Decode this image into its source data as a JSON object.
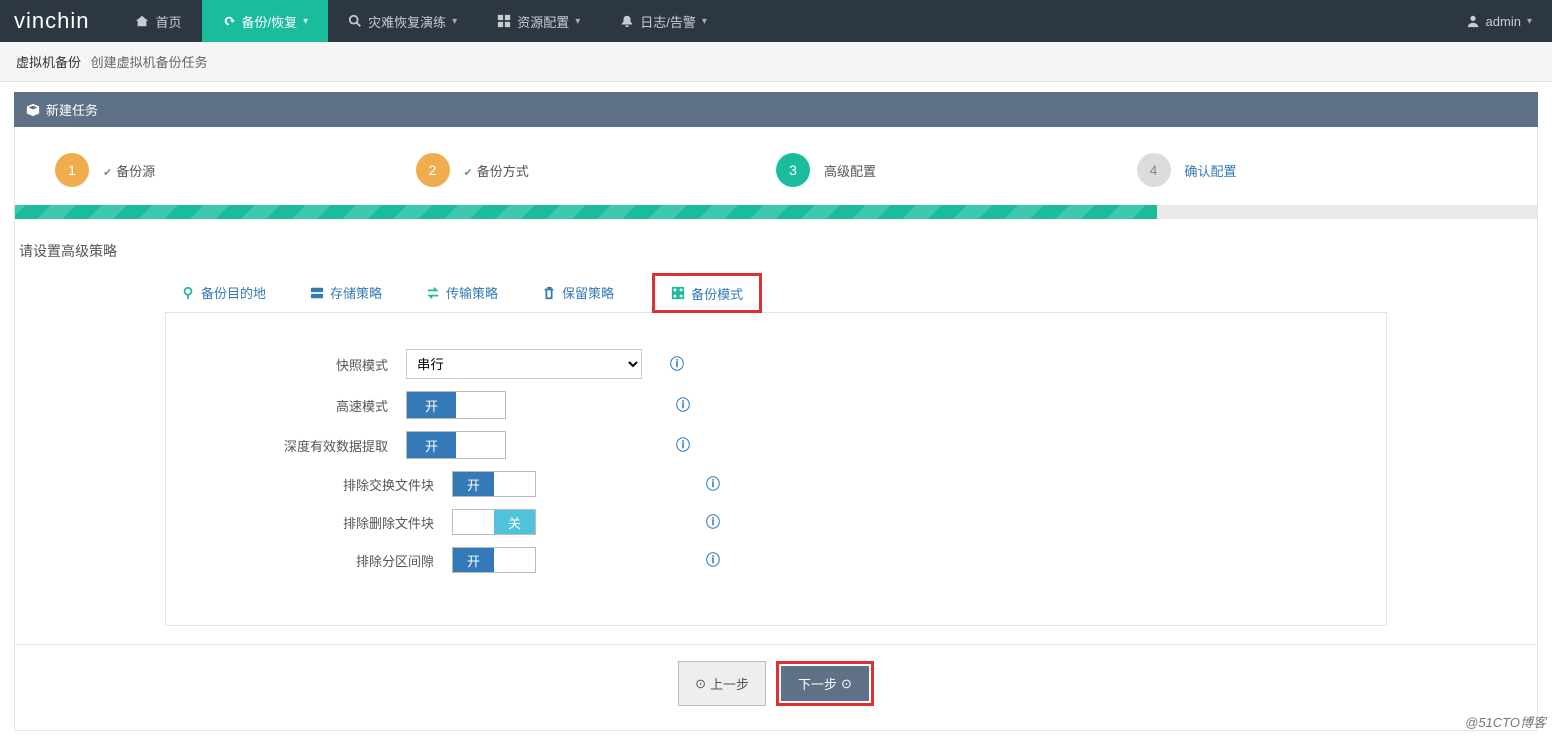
{
  "brand": "vinchin",
  "nav": {
    "home": "首页",
    "backup": "备份/恢复",
    "dr": "灾难恢复演练",
    "resource": "资源配置",
    "logs": "日志/告警",
    "user": "admin"
  },
  "breadcrumb": {
    "title": "虚拟机备份",
    "sub": "创建虚拟机备份任务"
  },
  "panel": {
    "title": "新建任务"
  },
  "steps": {
    "s1": {
      "num": "1",
      "label": "备份源"
    },
    "s2": {
      "num": "2",
      "label": "备份方式"
    },
    "s3": {
      "num": "3",
      "label": "高级配置"
    },
    "s4": {
      "num": "4",
      "label": "确认配置"
    }
  },
  "section": {
    "title": "请设置高级策略"
  },
  "tabs": {
    "dest": "备份目的地",
    "storage": "存储策略",
    "trans": "传输策略",
    "retain": "保留策略",
    "mode": "备份模式"
  },
  "form": {
    "snapshot_label": "快照模式",
    "snapshot_value": "串行",
    "speed_label": "高速模式",
    "deep_label": "深度有效数据提取",
    "swap_label": "排除交换文件块",
    "del_label": "排除删除文件块",
    "part_label": "排除分区间隙",
    "toggle_on": "开",
    "toggle_off": "关"
  },
  "buttons": {
    "prev": "上一步",
    "next": "下一步"
  },
  "watermark": "@51CTO博客"
}
